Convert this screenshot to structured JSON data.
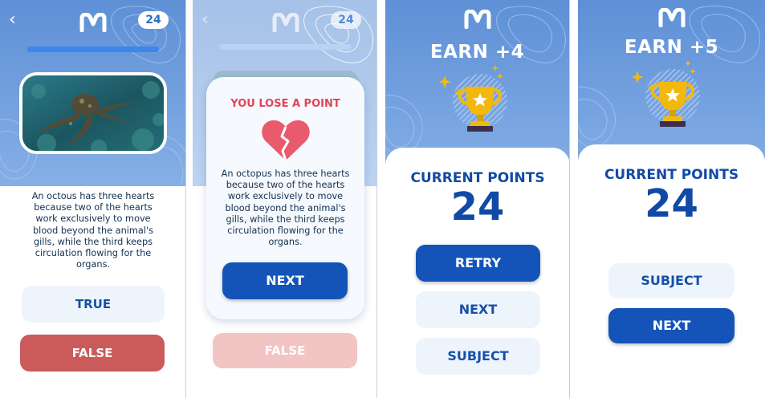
{
  "brand_mark": "M",
  "screen_quiz": {
    "counter": "24",
    "fact_text": "An octous has three hearts because two of the hearts work exclusively to move blood beyond the animal's gills, while the third keeps circulation flowing for the organs.",
    "true_label": "TRUE",
    "false_label": "FALSE"
  },
  "screen_lose": {
    "counter": "24",
    "heading": "YOU LOSE A POINT",
    "fact_text": "An octopus has three hearts because two of the hearts work exclusively to move blood beyond the animal's gills, while the third keeps circulation flowing for the organs.",
    "next_label": "NEXT",
    "false_label": "FALSE"
  },
  "screen_earn4": {
    "earn_text": "EARN +4",
    "current_points_label": "CURRENT POINTS",
    "points": "24",
    "retry_label": "RETRY",
    "next_label": "NEXT",
    "subject_label": "SUBJECT"
  },
  "screen_earn5": {
    "earn_text": "EARN +5",
    "current_points_label": "CURRENT POINTS",
    "points": "24",
    "subject_label": "SUBJECT",
    "next_label": "NEXT"
  },
  "colors": {
    "header_blue": "#5e90d6",
    "primary_button": "#1454b8",
    "false_button": "#cb5a5a",
    "false_button_disabled": "#f2c4c4",
    "light_button": "#eef4fc",
    "lose_heading": "#e0445a",
    "heart": "#e85a6c",
    "trophy_gold": "#f2b90c"
  },
  "icons": [
    "back-arrow-icon",
    "brand-logo-icon",
    "broken-heart-icon",
    "trophy-icon",
    "sparkle-icon",
    "octopus-photo"
  ]
}
